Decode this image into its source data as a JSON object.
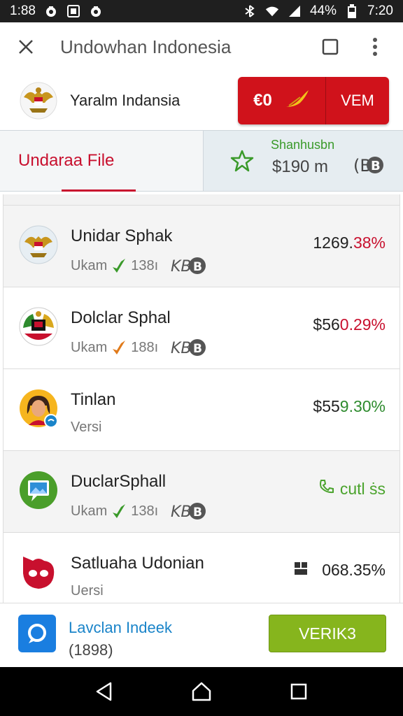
{
  "status_bar": {
    "time_left": "1:88",
    "battery": "44%",
    "time_right": "7:20"
  },
  "titlebar": {
    "title": "Undowhan Indonesia",
    "icons": [
      "close-icon",
      "square-icon",
      "more-vert-icon"
    ]
  },
  "brand": {
    "name": "Yaralm Indansia",
    "button": {
      "code": "€0",
      "label": "VEM"
    }
  },
  "tabs": {
    "file_label": "Undaraa File",
    "summary_title": "Shanhusbn",
    "summary_value": "$190 m",
    "summary_coin": "(B"
  },
  "rows": [
    {
      "name": "Unidar Sphak",
      "sub_text": "Ukam",
      "sub_num": "138ı",
      "badge": "KB",
      "value_main": "1269.",
      "value_accent": "38%",
      "accent_color": "#c8102e",
      "arrow_color": "#3a9a2a"
    },
    {
      "name": "Dolclar Sphal",
      "sub_text": "Ukam",
      "sub_num": "188ı",
      "badge": "KB",
      "value_main": "$56",
      "value_accent": "0.29%",
      "accent_color": "#c8102e",
      "arrow_color": "#e07a1a"
    },
    {
      "name": "Tinlan",
      "sub_text": "Versi",
      "value_main": "$55",
      "value_accent": "9.30%",
      "accent_color": "#2e8b2e"
    },
    {
      "name": "DuclarSphall",
      "sub_text": "Ukam",
      "sub_num": "138ı",
      "badge": "KB",
      "value_link": "cutl ṡs",
      "arrow_color": "#3a9a2a"
    },
    {
      "name": "Satluaha Udonian",
      "sub_text": "Uersi",
      "value_plain": "068.35%"
    }
  ],
  "footer": {
    "title": "Lavclan Indeek",
    "subtitle": "(1898)",
    "button_label": "VERIK3"
  }
}
